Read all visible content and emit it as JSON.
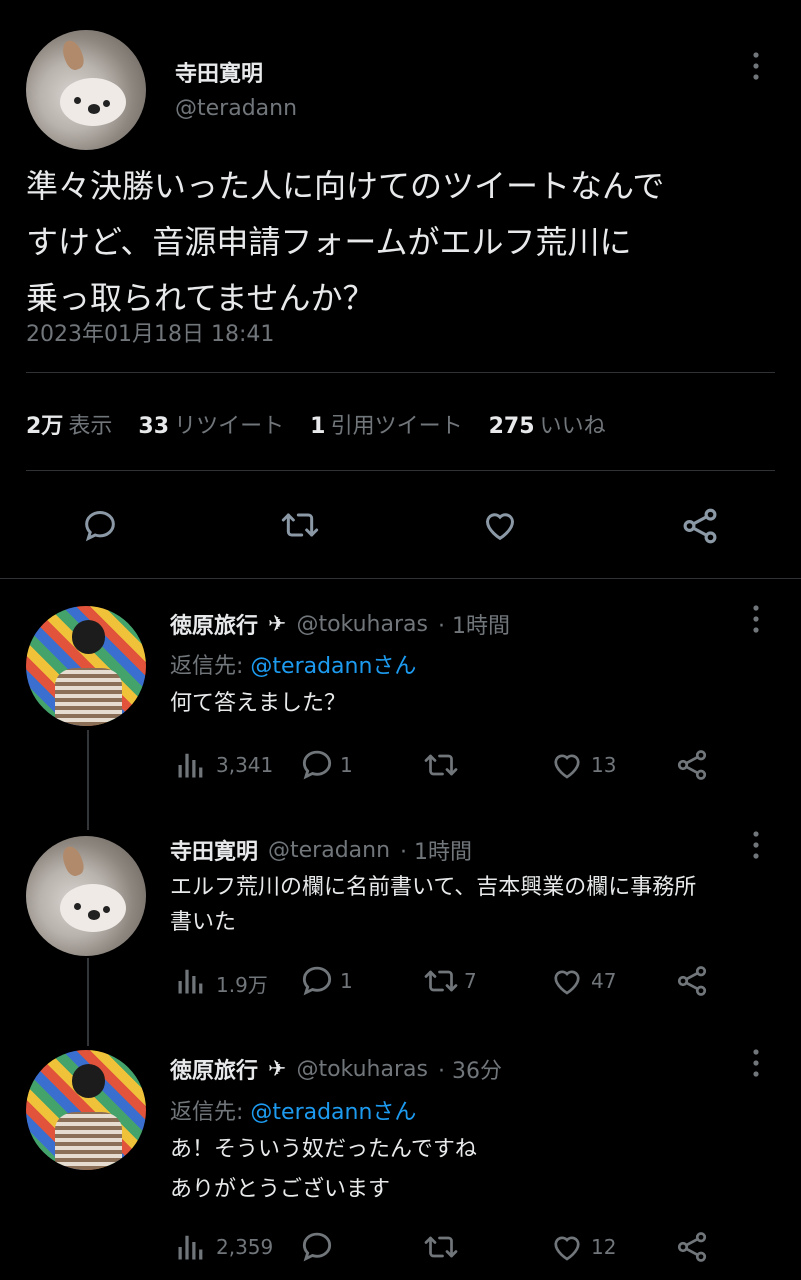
{
  "main_tweet": {
    "author_name": "寺田寛明",
    "author_handle": "@teradann",
    "text_lines": [
      "準々決勝いった人に向けてのツイートなんで",
      "すけど、音源申請フォームがエルフ荒川に",
      "乗っ取られてませんか？"
    ],
    "timestamp": "2023年01月18日 18:41",
    "stats": [
      {
        "num": "2万",
        "label": "表示"
      },
      {
        "num": "33",
        "label": "リツイート"
      },
      {
        "num": "1",
        "label": "引用ツイート"
      },
      {
        "num": "275",
        "label": "いいね"
      }
    ],
    "actions": [
      "reply-icon",
      "retweet-icon",
      "like-icon",
      "share-icon"
    ]
  },
  "replies": [
    {
      "name": "徳原旅行",
      "badge": "✈",
      "handle": "@tokuharas",
      "time": "· 1時間",
      "reply_to_prefix": "返信先: ",
      "reply_to": "@teradannさん",
      "text_lines": [
        "何て答えました？"
      ],
      "views": "3,341",
      "replies": "1",
      "retweets": "",
      "likes": "13"
    },
    {
      "name": "寺田寛明",
      "handle": "@teradann",
      "time": "· 1時間",
      "text_lines": [
        "エルフ荒川の欄に名前書いて、吉本興業の欄に事務所",
        "書いた"
      ],
      "views": "1.9万",
      "replies": "1",
      "retweets": "7",
      "likes": "47"
    },
    {
      "name": "徳原旅行",
      "badge": "✈",
      "handle": "@tokuharas",
      "time": "· 36分",
      "reply_to_prefix": "返信先: ",
      "reply_to": "@teradannさん",
      "text_lines": [
        "あ！そういう奴だったんですね",
        "ありがとうございます"
      ],
      "views": "2,359",
      "replies": "",
      "retweets": "",
      "likes": "12"
    }
  ],
  "colors": {
    "background": "#000000",
    "text": "#e7e9ea",
    "secondary": "#71767b",
    "link": "#1d9bf0",
    "divider": "#2f3336"
  }
}
